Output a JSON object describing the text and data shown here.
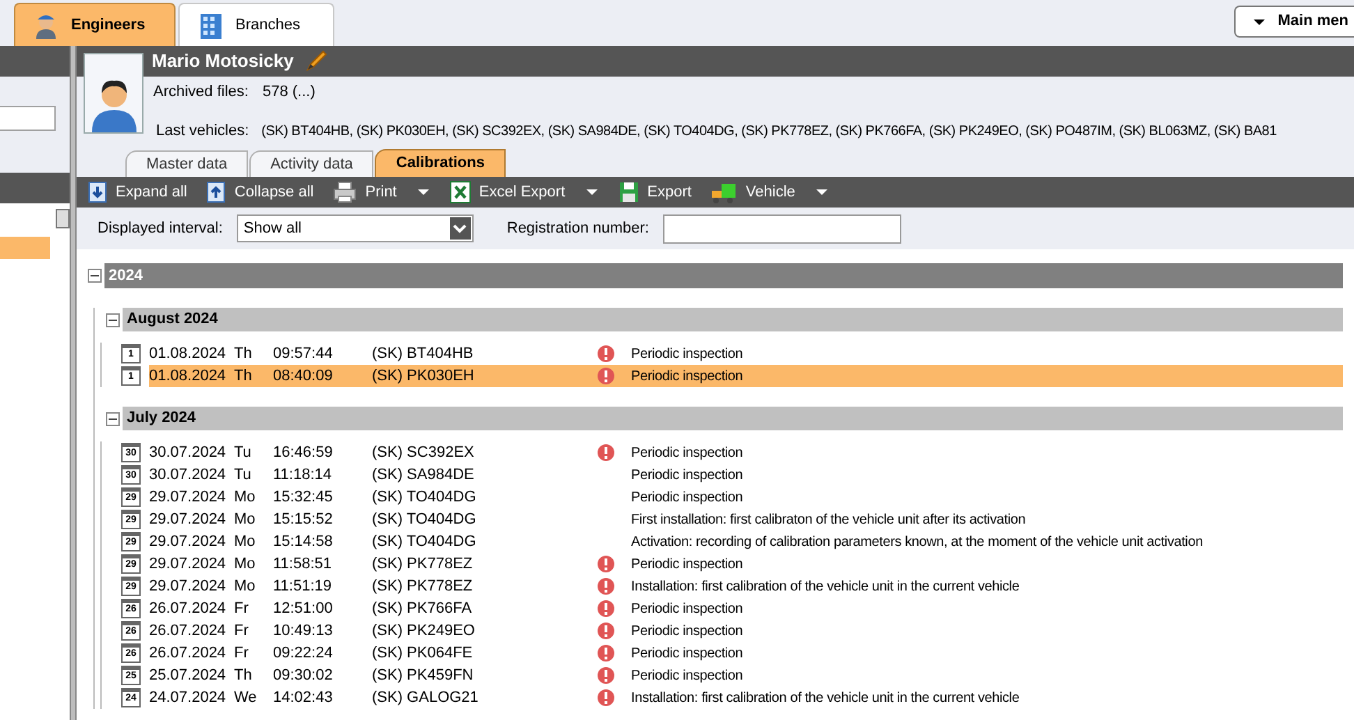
{
  "top_tabs": [
    {
      "label": "Engineers",
      "selected": true
    },
    {
      "label": "Branches",
      "selected": false
    }
  ],
  "main_menu": {
    "label": "Main men"
  },
  "engineer": {
    "name": "Mario Motosicky",
    "archived_label": "Archived files:",
    "archived_value": "578 (...)",
    "last_vehicles_label": "Last vehicles:",
    "last_vehicles_value": "(SK) BT404HB, (SK) PK030EH, (SK) SC392EX, (SK) SA984DE, (SK) TO404DG, (SK) PK778EZ, (SK) PK766FA, (SK) PK249EO, (SK) PO487IM, (SK) BL063MZ, (SK) BA81"
  },
  "sub_tabs": [
    {
      "label": "Master data",
      "selected": false
    },
    {
      "label": "Activity data",
      "selected": false
    },
    {
      "label": "Calibrations",
      "selected": true
    }
  ],
  "toolbar": [
    {
      "label": "Expand all",
      "has_menu": false
    },
    {
      "label": "Collapse all",
      "has_menu": false
    },
    {
      "label": "Print",
      "has_menu": true
    },
    {
      "label": "Excel Export",
      "has_menu": true
    },
    {
      "label": "Export",
      "has_menu": false
    },
    {
      "label": "Vehicle",
      "has_menu": true
    }
  ],
  "filters": {
    "interval_label": "Displayed interval:",
    "interval_value": "Show all",
    "registration_label": "Registration number:"
  },
  "tree": [
    {
      "label": "2024",
      "expanded": true,
      "children": [
        {
          "label": "August 2024",
          "expanded": true,
          "rows": [
            {
              "icon_day": "1",
              "date": "01.08.2024",
              "weekday": "Th",
              "time": "09:57:44",
              "vehicle": "(SK) BT404HB",
              "warning": true,
              "type": "Periodic inspection",
              "selected": false
            },
            {
              "icon_day": "1",
              "date": "01.08.2024",
              "weekday": "Th",
              "time": "08:40:09",
              "vehicle": "(SK) PK030EH",
              "warning": true,
              "type": "Periodic inspection",
              "selected": true
            }
          ]
        },
        {
          "label": "July 2024",
          "expanded": true,
          "rows": [
            {
              "icon_day": "30",
              "date": "30.07.2024",
              "weekday": "Tu",
              "time": "16:46:59",
              "vehicle": "(SK) SC392EX",
              "warning": true,
              "type": "Periodic inspection",
              "selected": false
            },
            {
              "icon_day": "30",
              "date": "30.07.2024",
              "weekday": "Tu",
              "time": "11:18:14",
              "vehicle": "(SK) SA984DE",
              "warning": false,
              "type": "Periodic inspection",
              "selected": false
            },
            {
              "icon_day": "29",
              "date": "29.07.2024",
              "weekday": "Mo",
              "time": "15:32:45",
              "vehicle": "(SK) TO404DG",
              "warning": false,
              "type": "Periodic inspection",
              "selected": false
            },
            {
              "icon_day": "29",
              "date": "29.07.2024",
              "weekday": "Mo",
              "time": "15:15:52",
              "vehicle": "(SK) TO404DG",
              "warning": false,
              "type": "First installation: first calibraton of the vehicle unit after its activation",
              "selected": false
            },
            {
              "icon_day": "29",
              "date": "29.07.2024",
              "weekday": "Mo",
              "time": "15:14:58",
              "vehicle": "(SK) TO404DG",
              "warning": false,
              "type": "Activation: recording of calibration parameters known, at the moment of the vehicle unit activation",
              "selected": false
            },
            {
              "icon_day": "29",
              "date": "29.07.2024",
              "weekday": "Mo",
              "time": "11:58:51",
              "vehicle": "(SK) PK778EZ",
              "warning": true,
              "type": "Periodic inspection",
              "selected": false
            },
            {
              "icon_day": "29",
              "date": "29.07.2024",
              "weekday": "Mo",
              "time": "11:51:19",
              "vehicle": "(SK) PK778EZ",
              "warning": true,
              "type": "Installation: first calibration of the vehicle unit in the current vehicle",
              "selected": false
            },
            {
              "icon_day": "26",
              "date": "26.07.2024",
              "weekday": "Fr",
              "time": "12:51:00",
              "vehicle": "(SK) PK766FA",
              "warning": true,
              "type": "Periodic inspection",
              "selected": false
            },
            {
              "icon_day": "26",
              "date": "26.07.2024",
              "weekday": "Fr",
              "time": "10:49:13",
              "vehicle": "(SK) PK249EO",
              "warning": true,
              "type": "Periodic inspection",
              "selected": false
            },
            {
              "icon_day": "26",
              "date": "26.07.2024",
              "weekday": "Fr",
              "time": "09:22:24",
              "vehicle": "(SK) PK064FE",
              "warning": true,
              "type": "Periodic inspection",
              "selected": false
            },
            {
              "icon_day": "25",
              "date": "25.07.2024",
              "weekday": "Th",
              "time": "09:30:02",
              "vehicle": "(SK) PK459FN",
              "warning": true,
              "type": "Periodic inspection",
              "selected": false
            },
            {
              "icon_day": "24",
              "date": "24.07.2024",
              "weekday": "We",
              "time": "14:02:43",
              "vehicle": "(SK) GALOG21",
              "warning": true,
              "type": "Installation: first calibration of the vehicle unit in the current vehicle",
              "selected": false
            }
          ]
        }
      ]
    }
  ]
}
